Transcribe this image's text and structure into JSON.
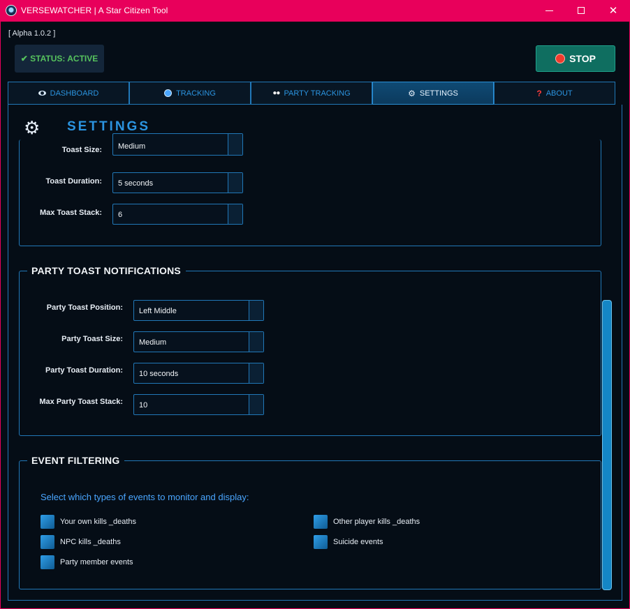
{
  "window": {
    "title": "VERSEWATCHER | A Star Citizen Tool",
    "minimize": "—",
    "close": "✕"
  },
  "version": "[ Alpha 1.0.2 ]",
  "status": {
    "text": "✔ STATUS: ACTIVE",
    "color": "#56c25d"
  },
  "stop_button": {
    "label": "STOP"
  },
  "tabs": [
    {
      "label": "DASHBOARD",
      "icon": "eye-icon"
    },
    {
      "label": "TRACKING",
      "icon": "radar-icon"
    },
    {
      "label": "PARTY TRACKING",
      "icon": "eyes-icon"
    },
    {
      "label": "SETTINGS",
      "icon": "gear-icon",
      "active": true
    },
    {
      "label": "ABOUT",
      "icon": "question-icon"
    }
  ],
  "settings": {
    "title": "SETTINGS",
    "toast": {
      "size_label": "Toast Size:",
      "size_value": "Medium",
      "duration_label": "Toast Duration:",
      "duration_value": "5 seconds",
      "stack_label": "Max Toast Stack:",
      "stack_value": "6"
    },
    "party_toast": {
      "title": "PARTY TOAST NOTIFICATIONS",
      "position_label": "Party Toast Position:",
      "position_value": "Left Middle",
      "size_label": "Party Toast Size:",
      "size_value": "Medium",
      "duration_label": "Party Toast Duration:",
      "duration_value": "10 seconds",
      "stack_label": "Max Party Toast Stack:",
      "stack_value": "10"
    },
    "event_filtering": {
      "title": "EVENT FILTERING",
      "help": "Select which types of events to monitor and display:",
      "options": [
        "Your own kills _deaths",
        "NPC kills _deaths",
        "Party member events",
        "Other player kills _deaths",
        "Suicide events"
      ]
    }
  },
  "colors": {
    "titlebar": "#e8005b",
    "accent": "#2b94e0",
    "border": "#2178b8",
    "background": "#050d16"
  }
}
